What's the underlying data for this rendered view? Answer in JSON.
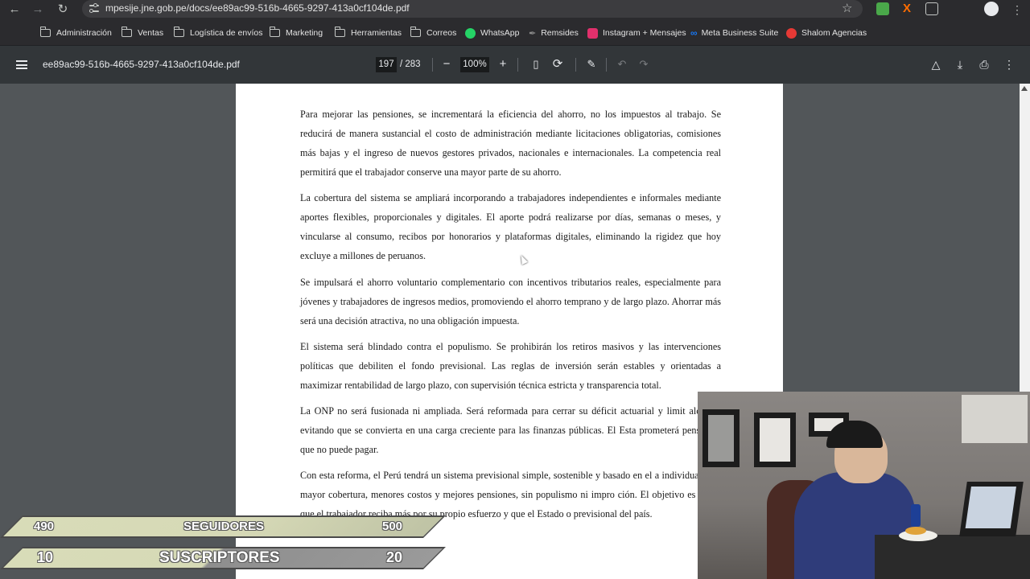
{
  "browser": {
    "url": "mpesije.jne.gob.pe/docs/ee89ac99-516b-4665-9297-413a0cf104de.pdf",
    "bookmarks": [
      {
        "label": "Administración",
        "icon": "folder-icon"
      },
      {
        "label": "Ventas",
        "icon": "folder-icon"
      },
      {
        "label": "Logística de envíos",
        "icon": "folder-icon"
      },
      {
        "label": "Marketing",
        "icon": "folder-icon"
      },
      {
        "label": "Herramientas",
        "icon": "folder-icon"
      },
      {
        "label": "Correos",
        "icon": "folder-icon"
      },
      {
        "label": "WhatsApp",
        "icon": "whatsapp-icon"
      },
      {
        "label": "Remsides",
        "icon": "feather-icon"
      },
      {
        "label": "Instagram + Mensajes",
        "icon": "instagram-icon"
      },
      {
        "label": "Meta Business Suite",
        "icon": "meta-icon"
      },
      {
        "label": "Shalom Agencias",
        "icon": "shalom-icon"
      }
    ],
    "colors": {
      "chrome": "#2b2b2e",
      "omnibox": "#3c3c3f",
      "whatsapp": "#25d366",
      "instagram": "#e1306c",
      "meta": "#1877f2",
      "shalom": "#e53935"
    }
  },
  "pdf": {
    "filename": "ee89ac99-516b-4665-9297-413a0cf104de.pdf",
    "current_page": "197",
    "total_pages": "/ 283",
    "zoom": "100%",
    "paragraphs": [
      "Para mejorar las pensiones, se incrementará la eficiencia del ahorro, no los impuestos al trabajo. Se reducirá de manera sustancial el costo de administración mediante licitaciones obligatorias, comisiones más bajas y el ingreso de nuevos gestores privados, nacionales e internacionales. La competencia real permitirá que el trabajador conserve una mayor parte de su ahorro.",
      "La cobertura del sistema se ampliará incorporando a trabajadores independientes e informales mediante aportes flexibles, proporcionales y digitales. El aporte podrá realizarse por días, semanas o meses, y vincularse al consumo, recibos por honorarios y plataformas digitales, eliminando la rigidez que hoy excluye a millones de peruanos.",
      "Se impulsará el ahorro voluntario complementario con incentivos tributarios reales, especialmente para jóvenes y trabajadores de ingresos medios, promoviendo el ahorro temprano y de largo plazo. Ahorrar más será una decisión atractiva, no una obligación impuesta.",
      "El sistema será blindado contra el populismo. Se prohibirán los retiros masivos y las intervenciones políticas que debiliten el fondo previsional. Las reglas de inversión serán estables y orientadas a maximizar rentabilidad de largo plazo, con supervisión técnica estricta y transparencia total.",
      "La ONP no será fusionada ni ampliada. Será reformada para cerrar su déficit actuarial y limit alcance, evitando que se convierta en una carga creciente para las finanzas públicas. El Esta prometerá pensiones que no puede pagar.",
      "Con esta reforma, el Perú tendrá un sistema previsional simple, sostenible y basado en el a individual, con mayor cobertura, menores costos y mejores pensiones, sin populismo ni impro ción. El objetivo es claro: que el trabajador reciba más por su propio esfuerzo y que el Estado o previsional del país."
    ]
  },
  "overlay": {
    "followers": {
      "current": "490",
      "label": "SEGUIDORES",
      "goal": "500"
    },
    "subscribers": {
      "current": "10",
      "label": "SUSCRIPTORES",
      "goal": "20"
    }
  }
}
